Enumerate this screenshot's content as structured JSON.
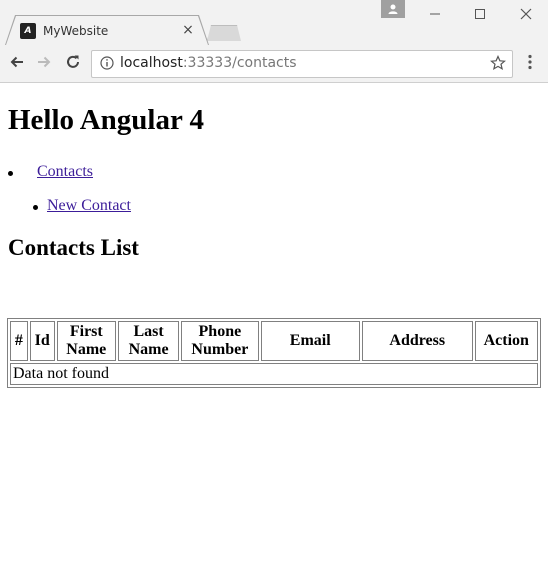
{
  "browser": {
    "tab_title": "MyWebsite",
    "tab_icon": "angular-logo-icon",
    "tab_close": "×",
    "url_host": "localhost",
    "url_rest": ":33333/contacts",
    "window_min": "—",
    "window_max": "☐",
    "window_close": "✕"
  },
  "page": {
    "heading": "Hello Angular 4",
    "nav": [
      {
        "label": "Contacts"
      },
      {
        "label": "New Contact"
      }
    ],
    "subheading": "Contacts List",
    "table": {
      "columns": [
        "#",
        "Id",
        "First Name",
        "Last Name",
        "Phone Number",
        "Email",
        "Address",
        "Action"
      ],
      "empty_message": "Data not found"
    }
  },
  "colors": {
    "chrome_bg": "#f2f2f2",
    "link": "#3c1d99"
  }
}
